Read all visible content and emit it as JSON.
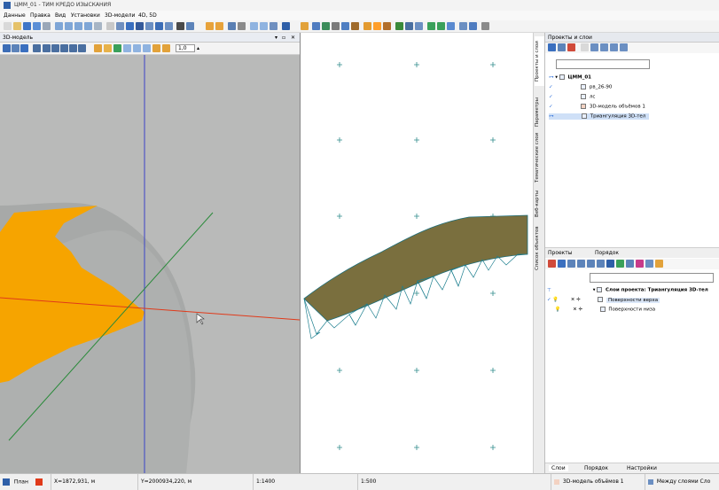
{
  "window": {
    "title": "ЦММ_01 - ТИМ КРЕДО ИЗЫСКАНИЯ"
  },
  "menu": [
    "Данные",
    "Правка",
    "Вид",
    "Установки",
    "3D-модели",
    "4D, 5D"
  ],
  "panel3d": {
    "title": "3D-модель",
    "zoom_value": "1,0"
  },
  "right_panel": {
    "title": "Проекты и слои",
    "side_tabs": [
      "Проекты и слои",
      "Параметры",
      "Тематические слои",
      "Веб-карты",
      "Список объектов"
    ],
    "tree": {
      "root": "ЦММ_01",
      "layers": [
        "рв_26-90",
        "лс",
        "3D-модель объёмов 1",
        "Триангуляция 3D-тел"
      ]
    },
    "lower_tabs": [
      "Проекты",
      "Порядок"
    ],
    "lower_tree": {
      "group": "Слои проекта: Триангуляция 3D-тел",
      "items": [
        "Поверхности верха",
        "Поверхности низа"
      ]
    },
    "bottom_tabs": [
      "Слои",
      "Порядок",
      "Настройки"
    ]
  },
  "status": {
    "mode": "План",
    "x": "X=1872,931, м",
    "y": "Y=2000934,220, м",
    "scale1": "1:1400",
    "scale2": "1:500",
    "layer": "3D-модель объёмов 1",
    "between_layers": "Между слоями Сло"
  },
  "colors": {
    "accent": "#2e6fd8",
    "orange_surface": "#f6a400",
    "mesh": "#1d6e7a",
    "texture": "#7a6f3e"
  }
}
